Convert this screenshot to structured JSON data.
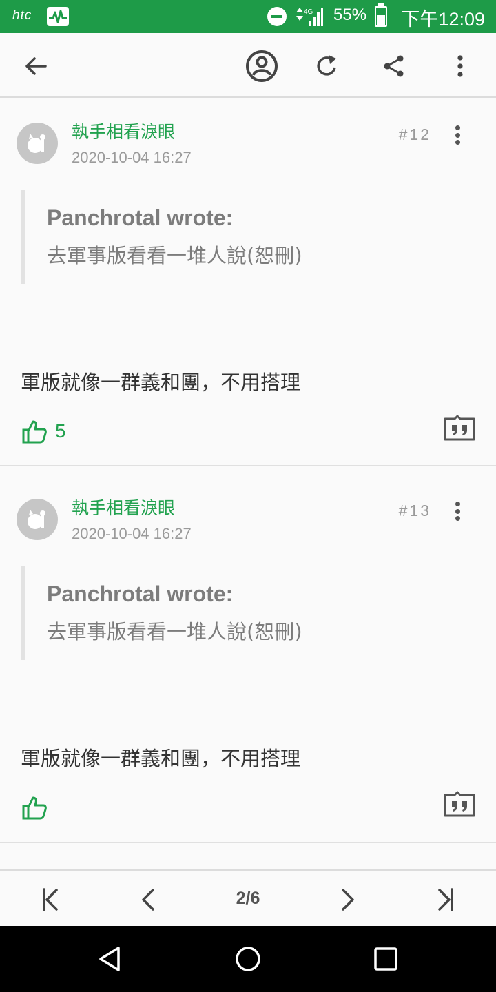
{
  "status_bar": {
    "carrier_logo": "htc",
    "battery_percent": "55%",
    "time": "下午12:09",
    "network_type": "4G"
  },
  "toolbar": {
    "back_icon": "arrow-left-icon",
    "account_icon": "account-circle-icon",
    "refresh_icon": "refresh-icon",
    "share_icon": "share-icon",
    "more_icon": "more-vertical-icon"
  },
  "posts": [
    {
      "author": "執手相看淚眼",
      "datetime": "2020-10-04 16:27",
      "floor": "#12",
      "quote": {
        "author": "Panchrotal wrote:",
        "text": "去軍事版看看一堆人說(恕刪)"
      },
      "body": "軍版就像一群義和團，不用搭理",
      "like_count": "5"
    },
    {
      "author": "執手相看淚眼",
      "datetime": "2020-10-04 16:27",
      "floor": "#13",
      "quote": {
        "author": "Panchrotal wrote:",
        "text": "去軍事版看看一堆人說(恕刪)"
      },
      "body": "軍版就像一群義和團，不用搭理",
      "like_count": ""
    }
  ],
  "pager": {
    "page_label": "2/6"
  },
  "colors": {
    "accent": "#22a24f",
    "status_bar": "#1e9b48",
    "muted_text": "#9a9a9a"
  }
}
